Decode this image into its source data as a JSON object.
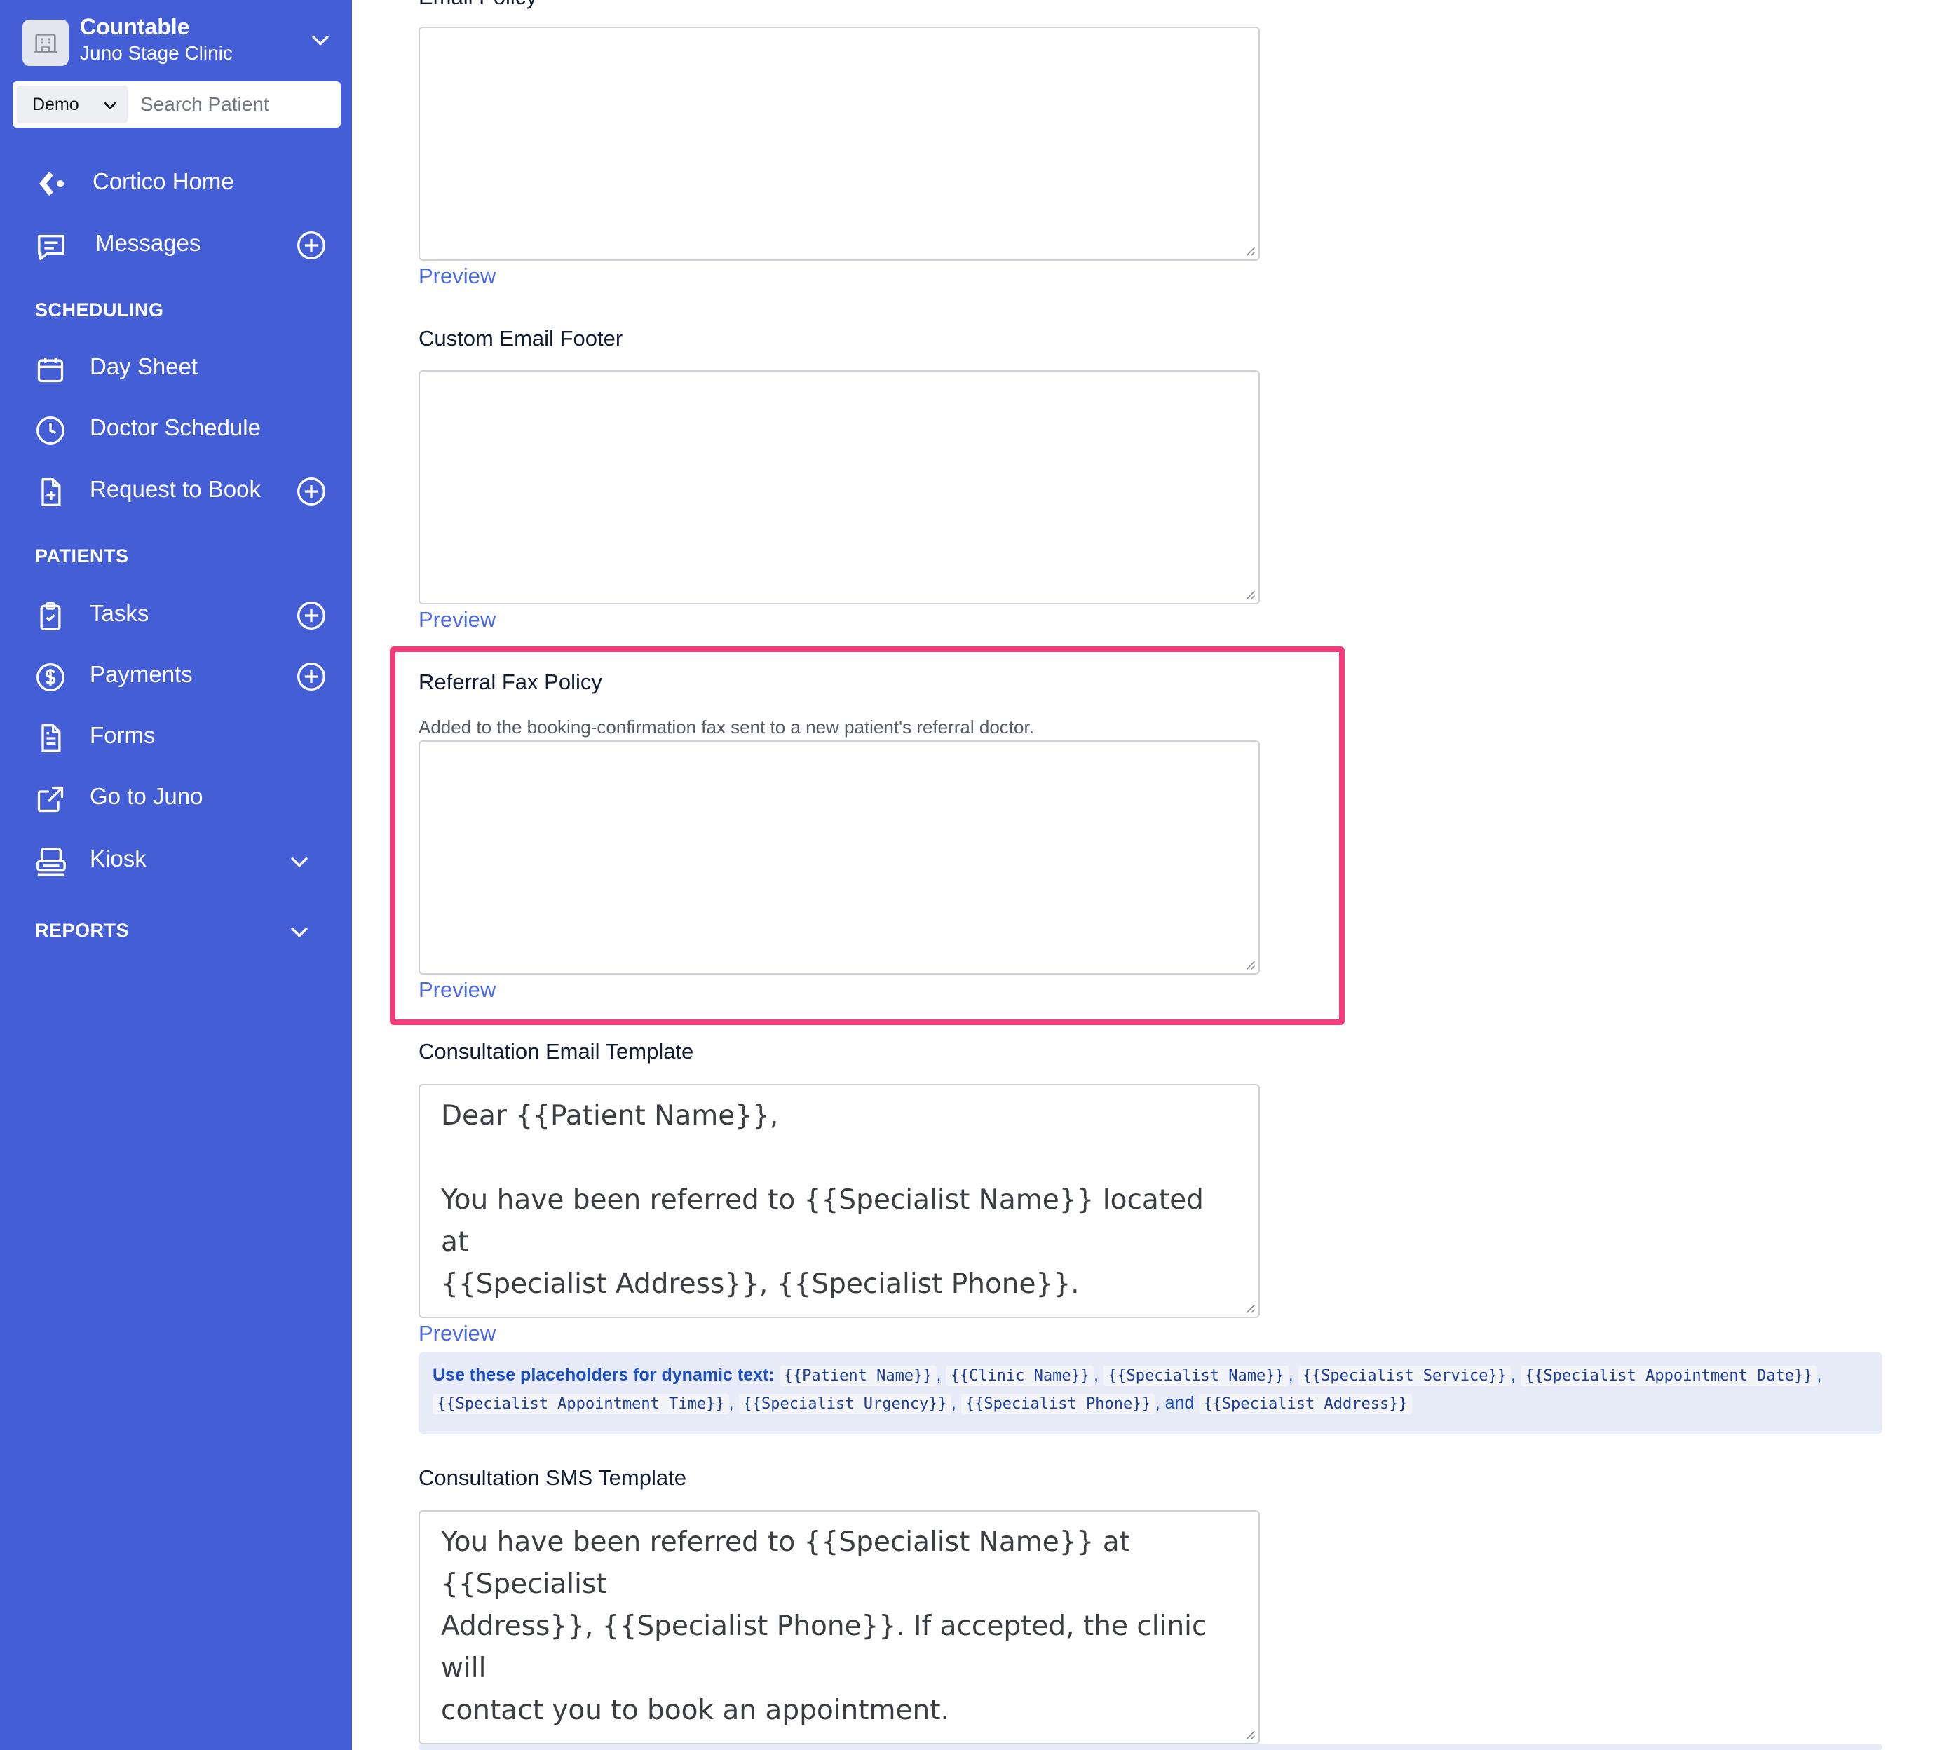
{
  "sidebar": {
    "brand": {
      "name": "Countable",
      "clinic": "Juno Stage Clinic",
      "logo_icon": "building-icon"
    },
    "search": {
      "env": "Demo",
      "placeholder": "Search Patient"
    },
    "nav": {
      "home": "Cortico Home",
      "messages": "Messages",
      "scheduling_title": "SCHEDULING",
      "day_sheet": "Day Sheet",
      "doctor_schedule": "Doctor Schedule",
      "request_to_book": "Request to Book",
      "patients_title": "PATIENTS",
      "tasks": "Tasks",
      "payments": "Payments",
      "forms": "Forms",
      "go_to_juno": "Go to Juno",
      "kiosk": "Kiosk",
      "reports_title": "REPORTS"
    },
    "colors": {
      "background": "#445ed6",
      "text": "#ffffff"
    }
  },
  "main": {
    "email_policy": {
      "label": "Email Policy",
      "value": "",
      "preview": "Preview"
    },
    "custom_email_footer": {
      "label": "Custom Email Footer",
      "value": "",
      "preview": "Preview"
    },
    "referral_fax_policy": {
      "label": "Referral Fax Policy",
      "help": "Added to the booking-confirmation fax sent to a new patient's referral doctor.",
      "value": "",
      "preview": "Preview"
    },
    "consultation_email_template": {
      "label": "Consultation Email Template",
      "line1": "Dear {{Patient Name}},",
      "line2": "You have been referred to {{Specialist Name}} located at",
      "line3": "{{Specialist Address}}, {{Specialist Phone}}.",
      "preview": "Preview"
    },
    "placeholders": {
      "lead": "Use these placeholders for dynamic text:",
      "items": [
        "{{Patient Name}}",
        "{{Clinic Name}}",
        "{{Specialist Name}}",
        "{{Specialist Service}}",
        "{{Specialist Appointment Date}}",
        "{{Specialist Appointment Time}}",
        "{{Specialist Urgency}}",
        "{{Specialist Phone}}",
        "{{Specialist Address}}"
      ],
      "separator": ",",
      "and": "and"
    },
    "consultation_sms_template": {
      "label": "Consultation SMS Template",
      "line1": "You have been referred to {{Specialist Name}} at {{Specialist",
      "line2": "Address}}, {{Specialist Phone}}. If accepted, the clinic will",
      "line3": "contact you to book an appointment."
    },
    "colors": {
      "link": "#4b6adb",
      "highlight": "#f23c78",
      "info_bg": "#e7ecf8"
    }
  }
}
